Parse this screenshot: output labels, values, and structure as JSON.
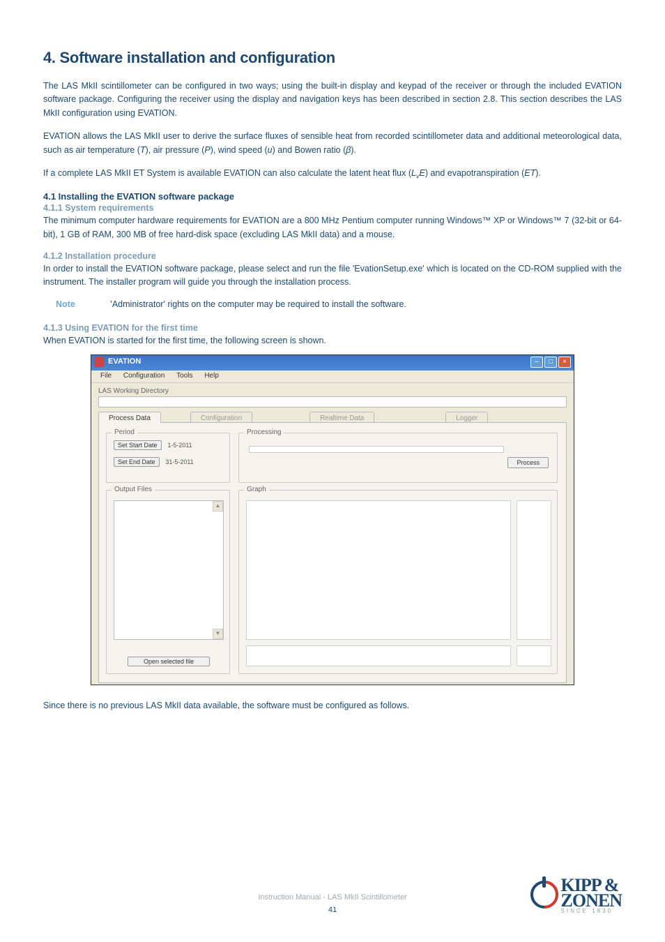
{
  "heading": "4. Software installation and configuration",
  "p1": "The LAS MkII scintillometer can be configured in two ways; using the built-in display and keypad of the receiver or through the included EVATION software package. Configuring the receiver using the display and navigation keys has been described in section 2.8. This section describes the LAS MkII configuration using EVATION.",
  "p2a": "EVATION allows the LAS MkII user to derive the surface fluxes of sensible heat from recorded scintillometer data and additional meteorological data, such as air temperature (",
  "p2b": "), air pressure (",
  "p2c": "), wind speed (",
  "p2d": ") and Bowen ratio (",
  "p2e": ").",
  "vars": {
    "T": "T",
    "P": "P",
    "u": "u",
    "beta": "β",
    "LvE_L": "L",
    "LvE_v": "v",
    "LvE_E": "E",
    "ET": "ET"
  },
  "p3a": "If a complete LAS MkII ET System is available EVATION can also calculate the latent heat flux (",
  "p3b": ") and evapotranspiration (",
  "p3c": ").",
  "h2_1": "4.1 Installing the EVATION software package",
  "h3_1": "4.1.1 System requirements",
  "p4": "The minimum computer hardware requirements for EVATION are a 800 MHz Pentium computer running Windows™ XP or Windows™ 7 (32-bit or 64-bit), 1 GB of RAM, 300 MB of free hard-disk space (excluding LAS MkII data) and a mouse.",
  "h3_2": "4.1.2 Installation procedure",
  "p5": "In order to install the EVATION software package, please select and run the file 'EvationSetup.exe' which is located on the CD-ROM supplied with the instrument. The installer program will guide you through the installation process.",
  "note_label": "Note",
  "note_text": "'Administrator' rights on the computer may be required to install the software.",
  "h3_3": "4.1.3 Using EVATION for the first time",
  "p6": "When EVATION is started for the first time, the following screen is shown.",
  "p7": "Since there is no previous LAS MkII data available, the software must be configured as follows.",
  "footer_text": "Instruction Manual - LAS MkII Scintillometer",
  "page_num": "41",
  "logo": {
    "line1": "KIPP &",
    "line2": "ZONEN",
    "since": "SINCE 1830"
  },
  "screenshot": {
    "title": "EVATION",
    "menu": {
      "file": "File",
      "config": "Configuration",
      "tools": "Tools",
      "help": "Help"
    },
    "lwd_label": "LAS Working Directory",
    "tabs": {
      "process": "Process Data",
      "config": "Configuration",
      "realtime": "Realtime Data",
      "logger": "Logger"
    },
    "period": {
      "label": "Period",
      "start_btn": "Set Start Date",
      "start_val": "1-5-2011",
      "end_btn": "Set End Date",
      "end_val": "31-5-2011"
    },
    "output": {
      "label": "Output Files",
      "open_btn": "Open selected file"
    },
    "processing": {
      "label": "Processing",
      "process_btn": "Process"
    },
    "graph": {
      "label": "Graph"
    },
    "winbtns": {
      "min": "–",
      "max": "□",
      "close": "×"
    }
  }
}
